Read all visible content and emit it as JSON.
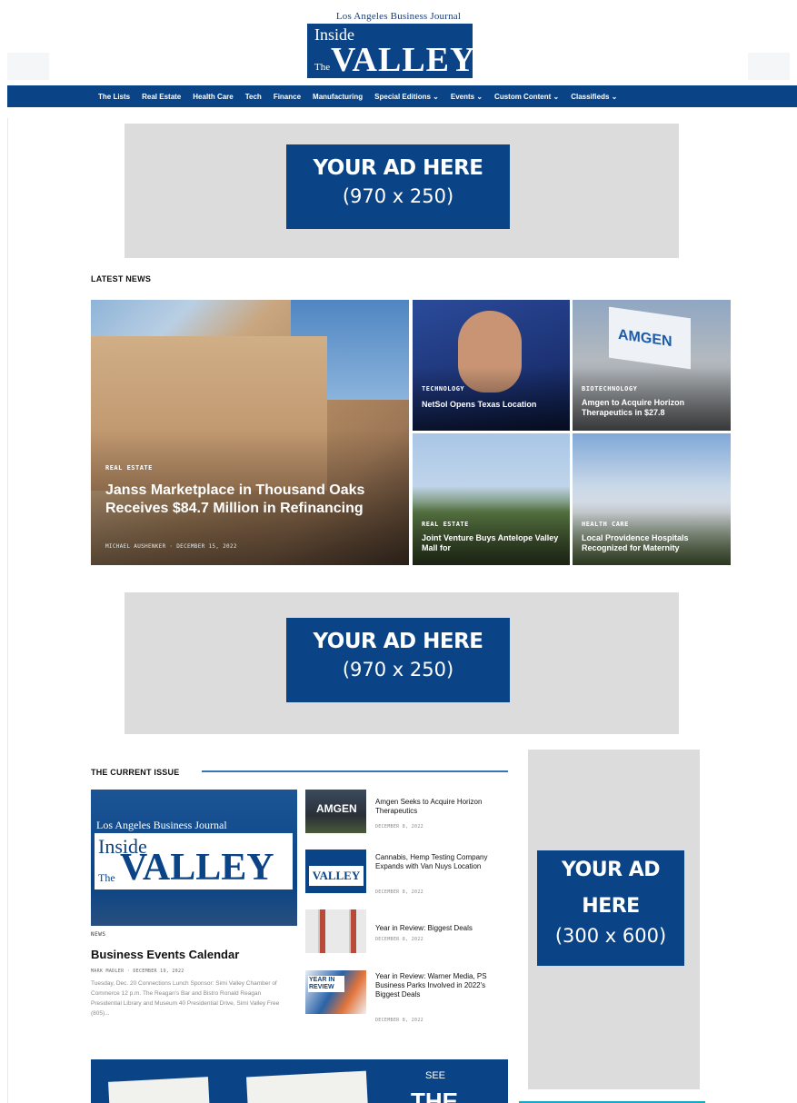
{
  "header": {
    "publisher": "Los Angeles Business Journal",
    "logo_inside": "Inside",
    "logo_the": "The",
    "logo_valley": "VALLEY"
  },
  "nav": {
    "items": [
      "The Lists",
      "Real Estate",
      "Health Care",
      "Tech",
      "Finance",
      "Manufacturing",
      "Special Editions ⌄",
      "Events ⌄",
      "Custom Content ⌄",
      "Classifieds ⌄"
    ]
  },
  "ads": {
    "top": {
      "title": "YOUR AD HERE",
      "size": "(970 x 250)"
    },
    "middle": {
      "title": "YOUR AD HERE",
      "size": "(970 x 250)"
    },
    "side": {
      "title_line1": "YOUR AD",
      "title_line2": "HERE",
      "size": "(300 x 600)"
    }
  },
  "latest_news": {
    "heading": "LATEST NEWS",
    "featured": {
      "category": "REAL ESTATE",
      "title": "Janss Marketplace in Thousand Oaks Receives $84.7 Million in Refinancing",
      "meta": "MICHAEL AUSHENKER · DECEMBER 15, 2022"
    },
    "tiles": [
      {
        "category": "TECHNOLOGY",
        "title": "NetSol Opens Texas Location"
      },
      {
        "category": "BIOTECHNOLOGY",
        "title": "Amgen to Acquire Horizon Therapeutics in $27.8"
      },
      {
        "category": "REAL ESTATE",
        "title": "Joint Venture Buys Antelope Valley Mall for"
      },
      {
        "category": "HEALTH CARE",
        "title": "Local Providence Hospitals Recognized for Maternity"
      }
    ],
    "amgen_flag": "AMGEN"
  },
  "current_issue": {
    "heading": "THE CURRENT ISSUE",
    "cover": {
      "publisher": "Los Angeles Business Journal",
      "inside": "Inside",
      "the": "The",
      "valley": "VALLEY"
    },
    "feature": {
      "category": "NEWS",
      "title": "Business Events Calendar",
      "meta": "MARK MADLER · DECEMBER 19, 2022",
      "excerpt": "Tuesday, Dec. 20 Connections Lunch Sponsor: Simi Valley Chamber of Commerce 12 p.m. The Reagan's Bar and Bistro Ronald Reagan Presidential Library and Museum 40 Presidential Drive, Simi Valley Free (805)..."
    },
    "list": [
      {
        "title": "Amgen Seeks to Acquire Horizon Therapeutics",
        "date": "DECEMBER 8, 2022",
        "thumb_text": "AMGEN"
      },
      {
        "title": "Cannabis, Hemp Testing Company Expands with Van Nuys Location",
        "date": "DECEMBER 8, 2022",
        "thumb_text": "VALLEY"
      },
      {
        "title": "Year in Review: Biggest Deals",
        "date": "DECEMBER 8, 2022",
        "thumb_text": ""
      },
      {
        "title": "Year in Review: Warner Media, PS Business Parks Involved in 2022's Biggest Deals",
        "date": "DECEMBER 8, 2022",
        "thumb_text": "YEAR IN REVIEW"
      }
    ]
  },
  "see_banner": {
    "small": "SEE",
    "big": "THE"
  }
}
